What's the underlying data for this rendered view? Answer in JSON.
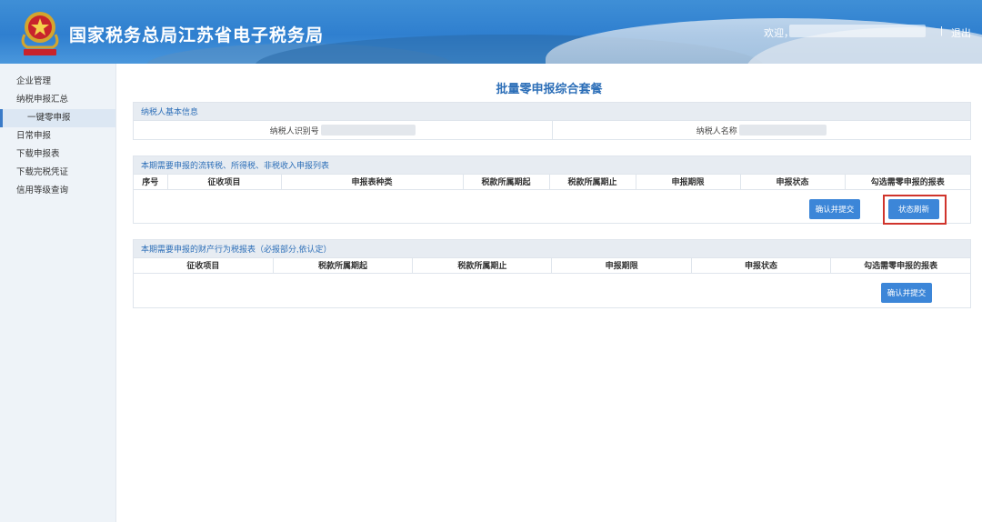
{
  "header": {
    "site_title": "国家税务总局江苏省电子税务局",
    "welcome": "欢迎，",
    "separator": "|",
    "logout_label": "退出"
  },
  "sidebar": {
    "items": [
      {
        "label": "企业管理"
      },
      {
        "label": "纳税申报汇总"
      },
      {
        "label": "一键零申报"
      },
      {
        "label": "日常申报"
      },
      {
        "label": "下载申报表"
      },
      {
        "label": "下载完税凭证"
      },
      {
        "label": "信用等级查询"
      }
    ]
  },
  "main": {
    "page_title": "批量零申报综合套餐",
    "basic_info": {
      "title": "纳税人基本信息",
      "taxpayer_id_label": "纳税人识别号",
      "taxpayer_name_label": "纳税人名称"
    },
    "turnover": {
      "title": "本期需要申报的流转税、所得税、非税收入申报列表",
      "columns": [
        "序号",
        "征收项目",
        "申报表种类",
        "税款所属期起",
        "税款所属期止",
        "申报期限",
        "申报状态",
        "勾选需零申报的报表"
      ],
      "confirm_label": "确认并提交",
      "refresh_label": "状态刷新"
    },
    "property": {
      "title": "本期需要申报的财产行为税报表（必报部分,依认定）",
      "columns": [
        "征收项目",
        "税款所属期起",
        "税款所属期止",
        "申报期限",
        "申报状态",
        "勾选需零申报的报表"
      ],
      "confirm_label": "确认并提交"
    }
  },
  "colors": {
    "header_blue": "#3f8fd6",
    "accent": "#2d6fb8",
    "button": "#3c86d8",
    "highlight": "#d0342c"
  },
  "icons": {
    "emblem": "national-tax-emblem-icon"
  }
}
